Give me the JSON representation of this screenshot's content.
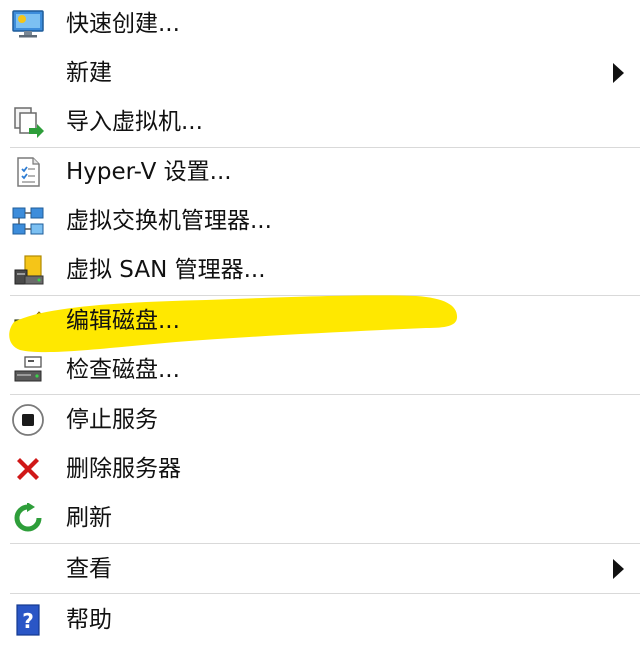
{
  "menu": {
    "items": [
      {
        "label": "快速创建..."
      },
      {
        "label": "新建"
      },
      {
        "label": "导入虚拟机..."
      },
      {
        "label": "Hyper-V 设置..."
      },
      {
        "label": "虚拟交换机管理器..."
      },
      {
        "label": "虚拟 SAN 管理器..."
      },
      {
        "label": "编辑磁盘..."
      },
      {
        "label": "检查磁盘..."
      },
      {
        "label": "停止服务"
      },
      {
        "label": "删除服务器"
      },
      {
        "label": "刷新"
      },
      {
        "label": "查看"
      },
      {
        "label": "帮助"
      }
    ]
  },
  "colors": {
    "highlight_marker": "#ffe800",
    "separator": "#d9d9d9",
    "delete_red": "#d01818",
    "refresh_green": "#2e9e3a",
    "help_blue": "#2a56c6"
  },
  "icons": [
    "quick-create-icon",
    "import-vm-icon",
    "hyperv-settings-icon",
    "virtual-switch-manager-icon",
    "virtual-san-manager-icon",
    "edit-disk-icon",
    "inspect-disk-icon",
    "stop-service-icon",
    "delete-server-icon",
    "refresh-icon",
    "help-icon"
  ]
}
